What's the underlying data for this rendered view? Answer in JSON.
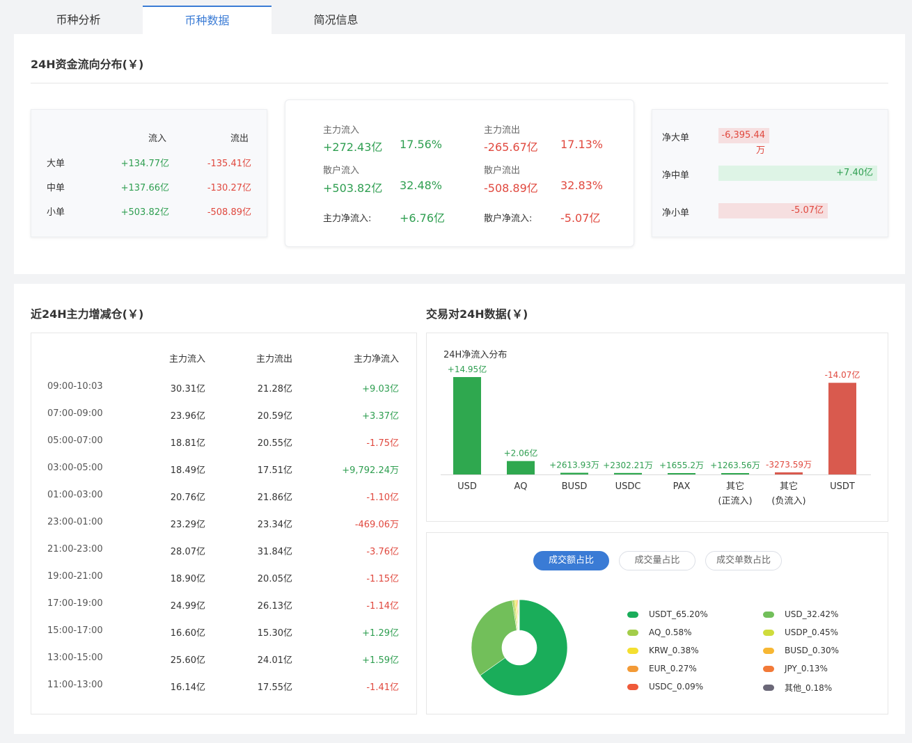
{
  "tabs": [
    {
      "label": "币种分析"
    },
    {
      "label": "币种数据"
    },
    {
      "label": "简况信息"
    }
  ],
  "flow": {
    "title": "24H资金流向分布(￥)",
    "left": {
      "col_in": "流入",
      "col_out": "流出",
      "rows": [
        {
          "label": "大单",
          "in": "+134.77亿",
          "out": "-135.41亿"
        },
        {
          "label": "中单",
          "in": "+137.66亿",
          "out": "-130.27亿"
        },
        {
          "label": "小单",
          "in": "+503.82亿",
          "out": "-508.89亿"
        }
      ]
    },
    "mid": {
      "main_in_label": "主力流入",
      "main_in_val": "+272.43亿",
      "main_in_pct": "17.56%",
      "main_out_label": "主力流出",
      "main_out_val": "-265.67亿",
      "main_out_pct": "17.13%",
      "retail_in_label": "散户流入",
      "retail_in_val": "+503.82亿",
      "retail_in_pct": "32.48%",
      "retail_out_label": "散户流出",
      "retail_out_val": "-508.89亿",
      "retail_out_pct": "32.83%",
      "main_net_label": "主力净流入:",
      "main_net_val": "+6.76亿",
      "retail_net_label": "散户净流入:",
      "retail_net_val": "-5.07亿"
    },
    "right": [
      {
        "label": "净大单",
        "value": "-6,395.44万",
        "fill": 0.32,
        "color": "red"
      },
      {
        "label": "净中单",
        "value": "+7.40亿",
        "fill": 1.0,
        "color": "green"
      },
      {
        "label": "净小单",
        "value": "-5.07亿",
        "fill": 0.69,
        "color": "red"
      }
    ]
  },
  "hourly": {
    "title": "近24H主力增减仓(￥)",
    "headers": {
      "in": "主力流入",
      "out": "主力流出",
      "net": "主力净流入"
    },
    "rows": [
      {
        "time": "09:00-10:03",
        "in": "30.31亿",
        "out": "21.28亿",
        "net": "+9.03亿",
        "sign": "green"
      },
      {
        "time": "07:00-09:00",
        "in": "23.96亿",
        "out": "20.59亿",
        "net": "+3.37亿",
        "sign": "green"
      },
      {
        "time": "05:00-07:00",
        "in": "18.81亿",
        "out": "20.55亿",
        "net": "-1.75亿",
        "sign": "red"
      },
      {
        "time": "03:00-05:00",
        "in": "18.49亿",
        "out": "17.51亿",
        "net": "+9,792.24万",
        "sign": "green"
      },
      {
        "time": "01:00-03:00",
        "in": "20.76亿",
        "out": "21.86亿",
        "net": "-1.10亿",
        "sign": "red"
      },
      {
        "time": "23:00-01:00",
        "in": "23.29亿",
        "out": "23.34亿",
        "net": "-469.06万",
        "sign": "red"
      },
      {
        "time": "21:00-23:00",
        "in": "28.07亿",
        "out": "31.84亿",
        "net": "-3.76亿",
        "sign": "red"
      },
      {
        "time": "19:00-21:00",
        "in": "18.90亿",
        "out": "20.05亿",
        "net": "-1.15亿",
        "sign": "red"
      },
      {
        "time": "17:00-19:00",
        "in": "24.99亿",
        "out": "26.13亿",
        "net": "-1.14亿",
        "sign": "red"
      },
      {
        "time": "15:00-17:00",
        "in": "16.60亿",
        "out": "15.30亿",
        "net": "+1.29亿",
        "sign": "green"
      },
      {
        "time": "13:00-15:00",
        "in": "25.60亿",
        "out": "24.01亿",
        "net": "+1.59亿",
        "sign": "green"
      },
      {
        "time": "11:00-13:00",
        "in": "16.14亿",
        "out": "17.55亿",
        "net": "-1.41亿",
        "sign": "red"
      }
    ]
  },
  "pairs": {
    "title": "交易对24H数据(￥)",
    "colors": {
      "positive": "#2fa84f",
      "negative": "#d95a4e"
    }
  },
  "pie_tabs": [
    {
      "label": "成交额占比",
      "active": true
    },
    {
      "label": "成交量占比",
      "active": false
    },
    {
      "label": "成交单数占比",
      "active": false
    }
  ],
  "chart_data": [
    {
      "type": "bar",
      "title": "24H净流入分布",
      "categories": [
        "USD",
        "AQ",
        "BUSD",
        "USDC",
        "PAX",
        "其它\n(正流入)",
        "其它\n(负流入)",
        "USDT"
      ],
      "category_lines": [
        [
          "USD"
        ],
        [
          "AQ"
        ],
        [
          "BUSD"
        ],
        [
          "USDC"
        ],
        [
          "PAX"
        ],
        [
          "其它",
          "(正流入)"
        ],
        [
          "其它",
          "(负流入)"
        ],
        [
          "USDT"
        ]
      ],
      "values": [
        14.95,
        2.06,
        0.261393,
        0.230221,
        0.16552,
        0.126356,
        -0.327359,
        -14.07
      ],
      "data_labels": [
        "+14.95亿",
        "+2.06亿",
        "+2613.93万",
        "+2302.21万",
        "+1655.2万",
        "+1263.56万",
        "-3273.59万",
        "-14.07亿"
      ]
    },
    {
      "type": "pie",
      "slices": [
        {
          "name": "USDT_65.20%",
          "value": 65.2,
          "color": "#1aad5a"
        },
        {
          "name": "USD_32.42%",
          "value": 32.42,
          "color": "#72bf5a"
        },
        {
          "name": "AQ_0.58%",
          "value": 0.58,
          "color": "#a3cd4a"
        },
        {
          "name": "USDP_0.45%",
          "value": 0.45,
          "color": "#cfdc3c"
        },
        {
          "name": "KRW_0.38%",
          "value": 0.38,
          "color": "#f4df30"
        },
        {
          "name": "BUSD_0.30%",
          "value": 0.3,
          "color": "#f7b733"
        },
        {
          "name": "EUR_0.27%",
          "value": 0.27,
          "color": "#f39a36"
        },
        {
          "name": "JPY_0.13%",
          "value": 0.13,
          "color": "#f27a38"
        },
        {
          "name": "USDC_0.09%",
          "value": 0.09,
          "color": "#ef5a3a"
        },
        {
          "name": "其他_0.18%",
          "value": 0.18,
          "color": "#6b6878"
        }
      ]
    }
  ]
}
